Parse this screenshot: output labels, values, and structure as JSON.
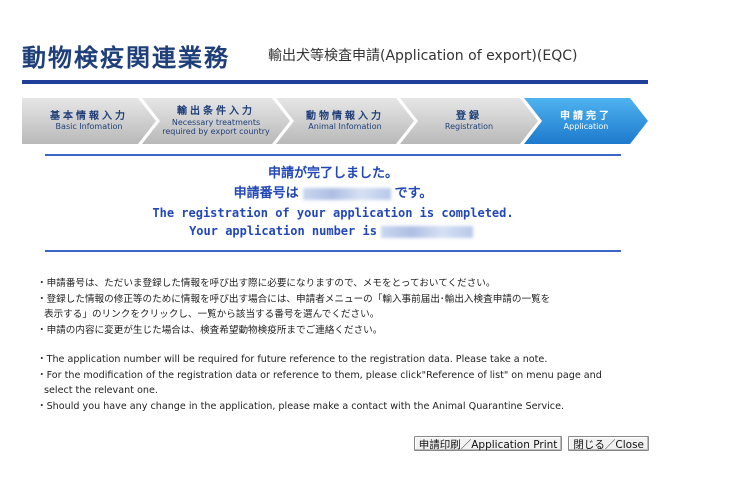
{
  "header": {
    "title": "動物検疫関連業務",
    "subtitle": "輸出犬等検査申請(Application of export)(EQC)"
  },
  "steps": [
    {
      "jp": "基本情報入力",
      "en": "Basic Infomation",
      "state": "inactive"
    },
    {
      "jp": "輸出条件入力",
      "en": "Necessary treatments required by export country",
      "state": "inactive"
    },
    {
      "jp": "動物情報入力",
      "en": "Animal Infomation",
      "state": "inactive"
    },
    {
      "jp": "登録",
      "en": "Registration",
      "state": "inactive"
    },
    {
      "jp": "申請完了",
      "en": "Application",
      "state": "active"
    }
  ],
  "result": {
    "jp_completed": "申請が完了しました。",
    "jp_number_prefix": "申請番号は",
    "jp_number_suffix": "です。",
    "en_completed": "The registration of your application is completed.",
    "en_number_prefix": "Your application number is"
  },
  "notes_jp": [
    "・申請番号は、ただいま登録した情報を呼び出す際に必要になりますので、メモをとっておいてください。",
    "・登録した情報の修正等のために情報を呼び出す場合には、申請者メニューの「輸入事前届出･輸出入検査申請の一覧を",
    "表示する」のリンクをクリックし、一覧から該当する番号を選んでください。",
    "・申請の内容に変更が生じた場合は、検査希望動物検疫所までご連絡ください。"
  ],
  "notes_en": [
    "・The application number will be required for future reference to the registration data. Please take a note.",
    "・For the modification of the registration data or reference to them, please click\"Reference of list\" on menu page and",
    "select the relevant one.",
    "・Should you have any change in the application, please make a contact with the Animal Quarantine Service."
  ],
  "actions": {
    "print_label": "申請印刷／Application Print",
    "close_label": "閉じる／Close"
  },
  "colors": {
    "title": "#1f3f7a",
    "rule": "#3b64c8",
    "result_text": "#2247b8",
    "active_step": "#1d79cc",
    "inactive_step": "#c8c8c8"
  }
}
